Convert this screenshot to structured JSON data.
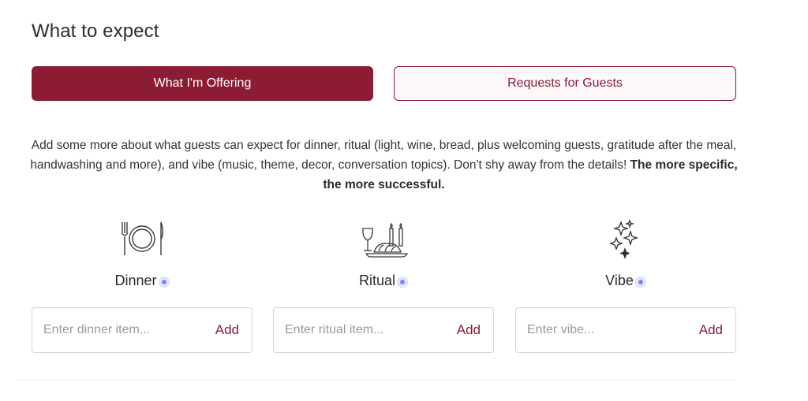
{
  "section": {
    "title": "What to expect"
  },
  "tabs": [
    {
      "label": "What I'm Offering",
      "active": true
    },
    {
      "label": "Requests for Guests",
      "active": false
    }
  ],
  "description": {
    "text": "Add some more about what guests can expect for dinner, ritual (light, wine, bread, plus welcoming guests, gratitude after the meal, handwashing and more), and vibe (music, theme, decor, conversation topics). Don't shy away from the details! ",
    "emphasis": "The more specific, the more successful."
  },
  "categories": [
    {
      "icon": "plate-cutlery-icon",
      "label": "Dinner",
      "placeholder": "Enter dinner item...",
      "value": "",
      "add_label": "Add"
    },
    {
      "icon": "wine-candles-challah-icon",
      "label": "Ritual",
      "placeholder": "Enter ritual item...",
      "value": "",
      "add_label": "Add"
    },
    {
      "icon": "sparkles-icon",
      "label": "Vibe",
      "placeholder": "Enter vibe...",
      "value": "",
      "add_label": "Add"
    }
  ],
  "colors": {
    "accent": "#8c1c34",
    "accent_light_bg": "#fdf8f9",
    "info_dot": "#7f86ee",
    "border": "#d5d5d5",
    "placeholder": "#9a9a9a"
  }
}
